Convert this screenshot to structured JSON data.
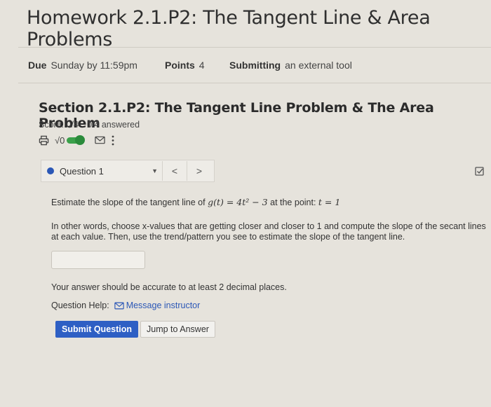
{
  "header": {
    "title": "Homework 2.1.P2: The Tangent Line & Area Problems"
  },
  "meta": {
    "due_label": "Due",
    "due_value": "Sunday by 11:59pm",
    "points_label": "Points",
    "points_value": "4",
    "submitting_label": "Submitting",
    "submitting_value": "an external tool"
  },
  "section": {
    "title": "Section 2.1.P2: The Tangent Line Problem & The Area Problem",
    "score": "Score: 0/4",
    "answered": "0/4 answered"
  },
  "toolbar": {
    "icons": [
      "printer-icon",
      "sqrt-toggle-icon",
      "mail-icon",
      "more-vertical-icon"
    ],
    "sqrt_label": "√0",
    "toggle_on": true,
    "accent": "#3aa04a"
  },
  "question_nav": {
    "selected": "Question 1",
    "prev": "<",
    "next": ">",
    "dot_color": "#2b57b6"
  },
  "question": {
    "prompt_prefix": "Estimate the slope of the tangent line of",
    "function_name": "g(t)",
    "equals": " = 4t² − 3",
    "prompt_middle": " at the point: ",
    "point": "t = 1",
    "instructions": "In other words, choose x-values that are getting closer and closer to 1 and compute the slope of the secant lines at each value. Then, use the trend/pattern you see to estimate the slope of the tangent line.",
    "answer_value": "",
    "accuracy_note": "Your answer should be accurate to at least 2 decimal places.",
    "help_label": "Question Help:",
    "help_link": "Message instructor"
  },
  "actions": {
    "submit": "Submit Question",
    "jump": "Jump to Answer",
    "submit_color": "#2e5fc4"
  }
}
